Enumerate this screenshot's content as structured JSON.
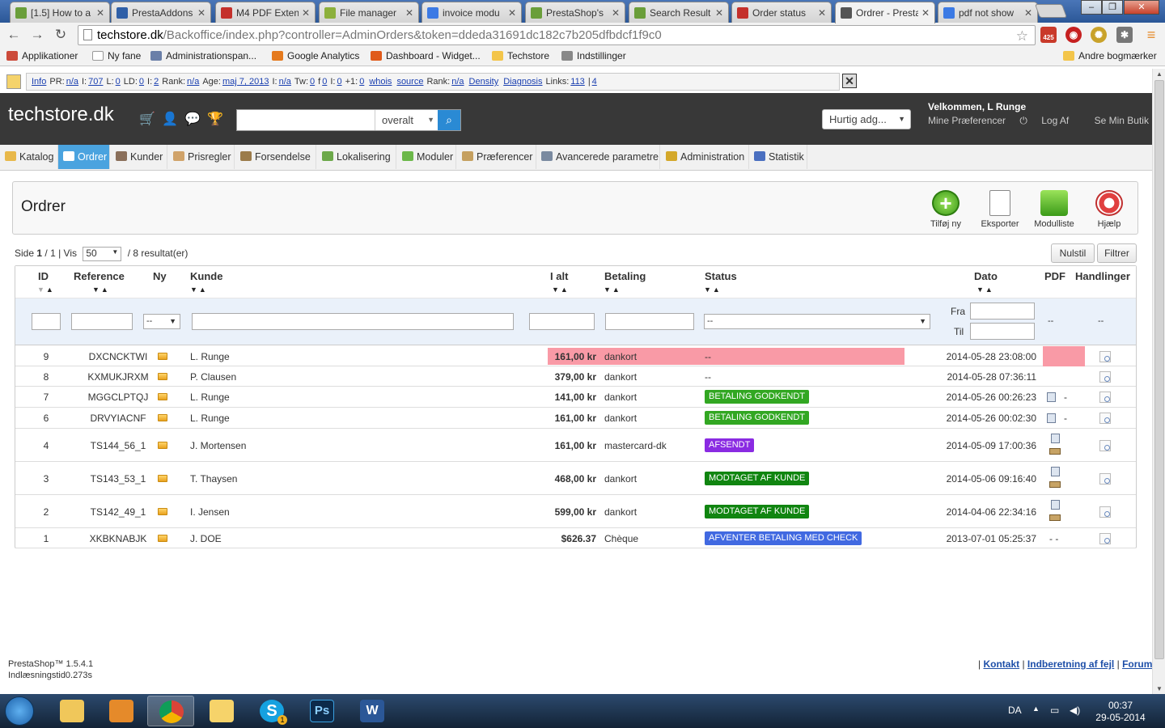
{
  "browser": {
    "tabs": [
      {
        "title": "[1.5] How to a",
        "color": "#6a9e3a"
      },
      {
        "title": "PrestaAddons",
        "color": "#2f5fa7"
      },
      {
        "title": "M4 PDF Exten",
        "color": "#c4302b"
      },
      {
        "title": "File manager",
        "color": "#8cb03c"
      },
      {
        "title": "invoice modu",
        "color": "#3c7ae4"
      },
      {
        "title": "PrestaShop's",
        "color": "#6a9e3a"
      },
      {
        "title": "Search Result",
        "color": "#6a9e3a"
      },
      {
        "title": "Order status",
        "color": "#c4302b"
      },
      {
        "title": "Ordrer - Presta",
        "color": "#555555"
      },
      {
        "title": "pdf not show",
        "color": "#3c7ae4"
      }
    ],
    "address": {
      "host": "techstore.dk",
      "path": "/Backoffice/index.php?controller=AdminOrders&token=ddeda31691dc182c7b205dfbdcf1f9c0"
    },
    "extension_badge": "425",
    "bookmarks": [
      "Applikationer",
      "Ny fane",
      "Administrationspan...",
      "Google Analytics",
      "Dashboard - Widget...",
      "Techstore",
      "Indstillinger"
    ],
    "other_bookmarks": "Andre bogmærker"
  },
  "seo_toolbar": {
    "items": [
      {
        "label": "",
        "link": "Info"
      },
      {
        "label": "PR:",
        "link": "n/a"
      },
      {
        "label": "I:",
        "link": "707"
      },
      {
        "label": "L:",
        "link": "0"
      },
      {
        "label": "LD:",
        "link": "0"
      },
      {
        "label": "I:",
        "link": "2"
      },
      {
        "label": "Rank:",
        "link": "n/a"
      },
      {
        "label": "Age:",
        "link": "maj 7, 2013"
      },
      {
        "label": "I:",
        "link": "n/a"
      },
      {
        "label": "Tw:",
        "link": "0"
      },
      {
        "label": "f",
        "link": "0"
      },
      {
        "label": "I:",
        "link": "0"
      },
      {
        "label": "+1:",
        "link": "0"
      },
      {
        "label": "",
        "link": "whois"
      },
      {
        "label": "",
        "link": "source"
      },
      {
        "label": "Rank:",
        "link": "n/a"
      },
      {
        "label": "",
        "link": "Density"
      },
      {
        "label": "",
        "link": "Diagnosis"
      },
      {
        "label": "Links:",
        "link": "113"
      },
      {
        "label": "|",
        "link": "4"
      }
    ]
  },
  "header": {
    "logo": "techstore.dk",
    "search_scope": "overalt",
    "quick_access": "Hurtig adg...",
    "welcome": "Velkommen, L Runge",
    "links": [
      "Mine Præferencer",
      "Log Af",
      "Se Min Butik"
    ]
  },
  "menu": [
    {
      "label": "Katalog",
      "color": "#e8b84a"
    },
    {
      "label": "Ordrer",
      "color": "#ffffff"
    },
    {
      "label": "Kunder",
      "color": "#8a6f5a"
    },
    {
      "label": "Prisregler",
      "color": "#d0a36a"
    },
    {
      "label": "Forsendelse",
      "color": "#9b7b4a"
    },
    {
      "label": "Lokalisering",
      "color": "#6ca84a"
    },
    {
      "label": "Moduler",
      "color": "#6cb84a"
    },
    {
      "label": "Præferencer",
      "color": "#c5a060"
    },
    {
      "label": "Avancerede parametre",
      "color": "#7a8aa0"
    },
    {
      "label": "Administration",
      "color": "#d4a82a"
    },
    {
      "label": "Statistik",
      "color": "#4a6fc0"
    }
  ],
  "page": {
    "title": "Ordrer",
    "actions": [
      "Tilføj ny",
      "Eksporter",
      "Modulliste",
      "Hjælp"
    ],
    "pager": {
      "prefix": "Side",
      "page": "1",
      "of": "/ 1 | Vis",
      "per_page": "50",
      "results": "/ 8 resultat(er)"
    },
    "reset_label": "Nulstil",
    "filter_label": "Filtrer"
  },
  "table": {
    "columns": [
      "ID",
      "Reference",
      "Ny",
      "Kunde",
      "I alt",
      "Betaling",
      "Status",
      "Dato",
      "PDF",
      "Handlinger"
    ],
    "filter": {
      "ny_option": "--",
      "status_option": "--",
      "from_label": "Fra",
      "to_label": "Til",
      "pdf_dash": "--",
      "actions_dash": "--"
    },
    "rows": [
      {
        "id": "9",
        "ref": "DXCNCKTWI",
        "kunde": "L. Runge",
        "total": "161,00 kr",
        "payment": "dankort",
        "status": "--",
        "status_color": "",
        "date": "2014-05-28 23:08:00",
        "pdf": "",
        "highlight": true
      },
      {
        "id": "8",
        "ref": "KXMUKJRXM",
        "kunde": "P. Clausen",
        "total": "379,00 kr",
        "payment": "dankort",
        "status": "--",
        "status_color": "",
        "date": "2014-05-28 07:36:11",
        "pdf": "",
        "highlight": false
      },
      {
        "id": "7",
        "ref": "MGGCLPTQJ",
        "kunde": "L. Runge",
        "total": "141,00 kr",
        "payment": "dankort",
        "status": "BETALING GODKENDT",
        "status_color": "#32a722",
        "date": "2014-05-26 00:26:23",
        "pdf": "-",
        "highlight": false
      },
      {
        "id": "6",
        "ref": "DRVYIACNF",
        "kunde": "L. Runge",
        "total": "161,00 kr",
        "payment": "dankort",
        "status": "BETALING GODKENDT",
        "status_color": "#32a722",
        "date": "2014-05-26 00:02:30",
        "pdf": "-",
        "highlight": false
      },
      {
        "id": "4",
        "ref": "TS144_56_1",
        "kunde": "J. Mortensen",
        "total": "161,00 kr",
        "payment": "mastercard-dk",
        "status": "AFSENDT",
        "status_color": "#8a2be2",
        "date": "2014-05-09 17:00:36",
        "pdf": "",
        "highlight": false
      },
      {
        "id": "3",
        "ref": "TS143_53_1",
        "kunde": "T. Thaysen",
        "total": "468,00 kr",
        "payment": "dankort",
        "status": "MODTAGET AF KUNDE",
        "status_color": "#108510",
        "date": "2014-05-06 09:16:40",
        "pdf": "",
        "highlight": false
      },
      {
        "id": "2",
        "ref": "TS142_49_1",
        "kunde": "I. Jensen",
        "total": "599,00 kr",
        "payment": "dankort",
        "status": "MODTAGET AF KUNDE",
        "status_color": "#108510",
        "date": "2014-04-06 22:34:16",
        "pdf": "",
        "highlight": false
      },
      {
        "id": "1",
        "ref": "XKBKNABJK",
        "kunde": "J. DOE",
        "total": "$626.37",
        "payment": "Chèque",
        "status": "AFVENTER BETALING MED CHECK",
        "status_color": "#4169e1",
        "date": "2013-07-01 05:25:37",
        "pdf": "- -",
        "highlight": false
      }
    ]
  },
  "footer": {
    "version": "PrestaShop™ 1.5.4.1",
    "load_time": "Indlæsningstid0.273s",
    "links": [
      "Kontakt",
      "Indberetning af fejl",
      "Forum"
    ]
  },
  "taskbar": {
    "lang": "DA",
    "time": "00:37",
    "date": "29-05-2014",
    "skype_badge": "1"
  }
}
